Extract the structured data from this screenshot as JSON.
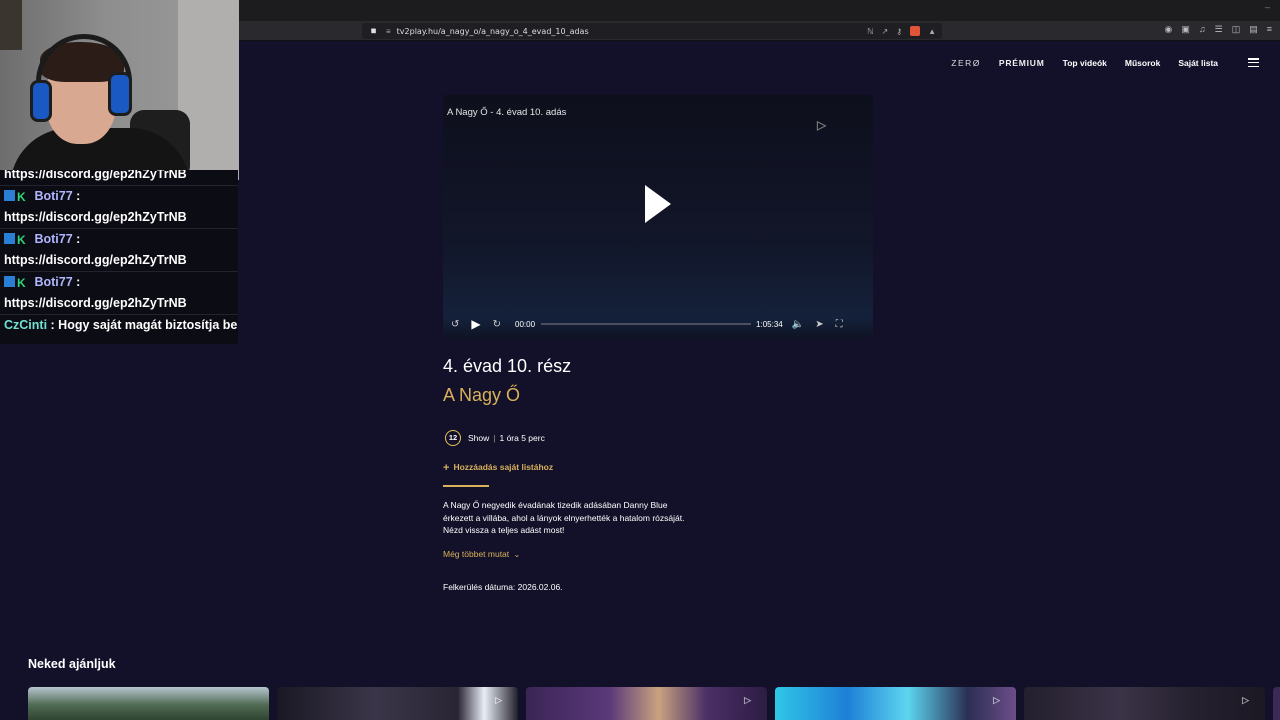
{
  "browser": {
    "url": "tv2play.hu/a_nagy_o/a_nagy_o_4_evad_10_adas",
    "shield_count": "8"
  },
  "chat": {
    "partial_top": "https://discord.gg/ep2hZyTrNB",
    "messages": [
      {
        "user": "Boti77",
        "sep": " :",
        "text": "https://discord.gg/ep2hZyTrNB"
      },
      {
        "user": "Boti77",
        "sep": " :",
        "text": "https://discord.gg/ep2hZyTrNB"
      },
      {
        "user": "Boti77",
        "sep": " :",
        "text": "https://discord.gg/ep2hZyTrNB"
      }
    ],
    "last": {
      "user": "CzCinti",
      "sep": " : ",
      "text": "Hogy saját magát biztosítja be"
    }
  },
  "nav": {
    "zero": "ZERØ",
    "premium": "PRÉMIUM",
    "top_videos": "Top videók",
    "shows": "Műsorok",
    "my_list": "Saját lista"
  },
  "player": {
    "title": "A Nagy Ő - 4. évad 10. adás",
    "current_time": "00:00",
    "duration": "1:05:34",
    "progress": 0
  },
  "episode": {
    "title": "4. évad 10. rész",
    "show": "A Nagy Ő",
    "age_rating": "12",
    "genre": "Show",
    "length": "1 óra 5 perc",
    "add_to_list": "Hozzáadás saját listához",
    "description_lines": [
      "A Nagy Ő negyedik évadának tizedik adásában Danny Blue",
      "érkezett a villába, ahol a lányok elnyerhették a hatalom rózsáját.",
      "Nézd vissza a teljes adást most!"
    ],
    "show_more": "Még többet mutat",
    "release": "Felkerülés dátuma: 2026.02.06."
  },
  "recommendations": {
    "title": "Neked ajánljuk"
  },
  "colors": {
    "page_bg": "#13112a",
    "accent_gold": "#d8b15a"
  }
}
